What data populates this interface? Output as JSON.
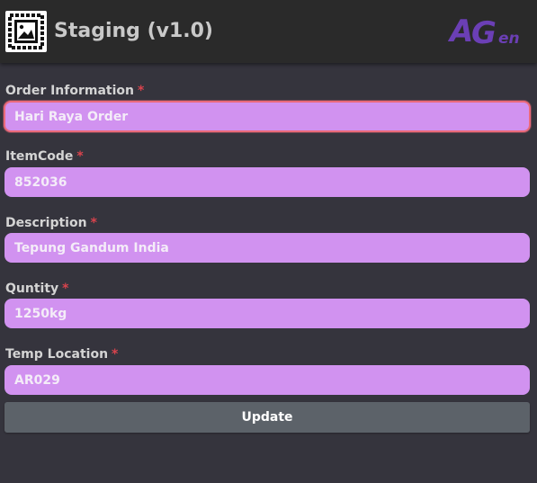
{
  "app": {
    "title": "Staging (v1.0)",
    "icon": "image-placeholder-icon",
    "logo_text_a": "A",
    "logo_text_g": "G",
    "logo_text_en": "en"
  },
  "form": {
    "fields": [
      {
        "label": "Order Information",
        "required_mark": "*",
        "value": "Hari Raya Order",
        "focused": true
      },
      {
        "label": "ItemCode",
        "required_mark": "*",
        "value": "852036"
      },
      {
        "label": "Description",
        "required_mark": "*",
        "value": "Tepung Gandum India"
      },
      {
        "label": "Quntity",
        "required_mark": "*",
        "value": "1250kg"
      },
      {
        "label": "Temp Location",
        "required_mark": "*",
        "value": "AR029"
      }
    ],
    "submit_label": "Update"
  },
  "colors": {
    "background": "#35343d",
    "header": "#2a2a2a",
    "input_fill": "#d192f0",
    "focus_border": "#ea6a7a",
    "required": "#d9434d",
    "button": "#5c6269",
    "logo": "#6b3fb5"
  }
}
